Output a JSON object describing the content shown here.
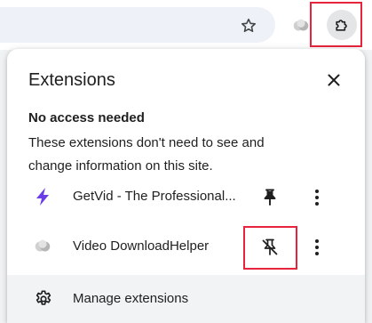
{
  "toolbar": {
    "star_icon": "star-icon",
    "extension_icon": "video-downloadhelper-icon",
    "extensions_button_icon": "puzzle-icon"
  },
  "popup": {
    "title": "Extensions",
    "close_icon": "close-icon",
    "section": {
      "heading": "No access needed",
      "description": "These extensions don't need to see and change information on this site."
    },
    "extensions": [
      {
        "name": "GetVid - The Professional...",
        "icon": "getvid-bolt-icon",
        "pinned": true,
        "pin_icon": "pin-icon",
        "more_icon": "more-vert-icon"
      },
      {
        "name": "Video DownloadHelper",
        "icon": "video-downloadhelper-icon",
        "pinned": false,
        "pin_icon": "unpin-icon",
        "more_icon": "more-vert-icon"
      }
    ],
    "manage": {
      "label": "Manage extensions",
      "icon": "gear-icon"
    }
  },
  "colors": {
    "highlight": "#e8233c",
    "getvid_accent": "#6a3de8",
    "text": "#1f1f1f",
    "icon": "#444746"
  }
}
